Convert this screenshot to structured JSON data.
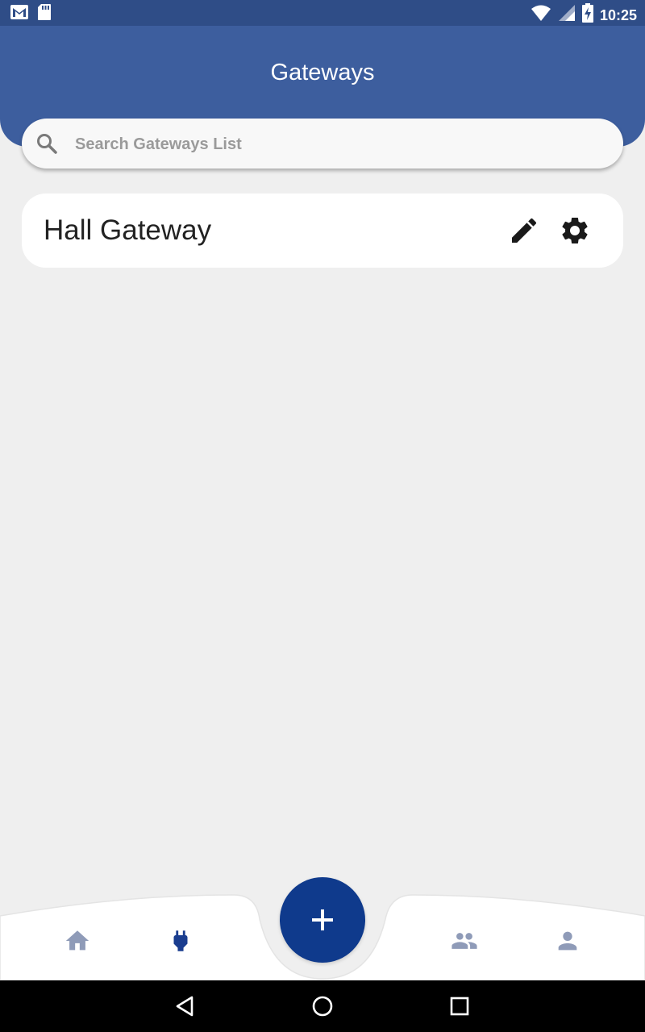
{
  "status_bar": {
    "time": "10:25",
    "icons_left": [
      "gmail-icon",
      "sd-card-icon"
    ],
    "icons_right": [
      "wifi-icon",
      "signal-icon",
      "battery-charging-icon"
    ]
  },
  "header": {
    "title": "Gateways"
  },
  "search": {
    "placeholder": "Search Gateways List",
    "value": ""
  },
  "gateways": [
    {
      "name": "Hall Gateway",
      "actions": [
        "edit-icon",
        "settings-icon"
      ]
    }
  ],
  "bottom_nav": {
    "items": [
      {
        "icon": "home-icon",
        "active": false
      },
      {
        "icon": "plug-icon",
        "active": true
      },
      {
        "icon": "group-icon",
        "active": false
      },
      {
        "icon": "person-icon",
        "active": false
      }
    ],
    "fab_icon": "add-icon"
  },
  "system_nav": [
    "back-icon",
    "home-circle-icon",
    "recents-icon"
  ],
  "colors": {
    "header": "#3d5e9e",
    "status_bar": "#2f4d87",
    "fab": "#0f3a8c",
    "nav_active": "#1a3d8f",
    "nav_inactive": "#8f9bb8",
    "background": "#efefef"
  }
}
